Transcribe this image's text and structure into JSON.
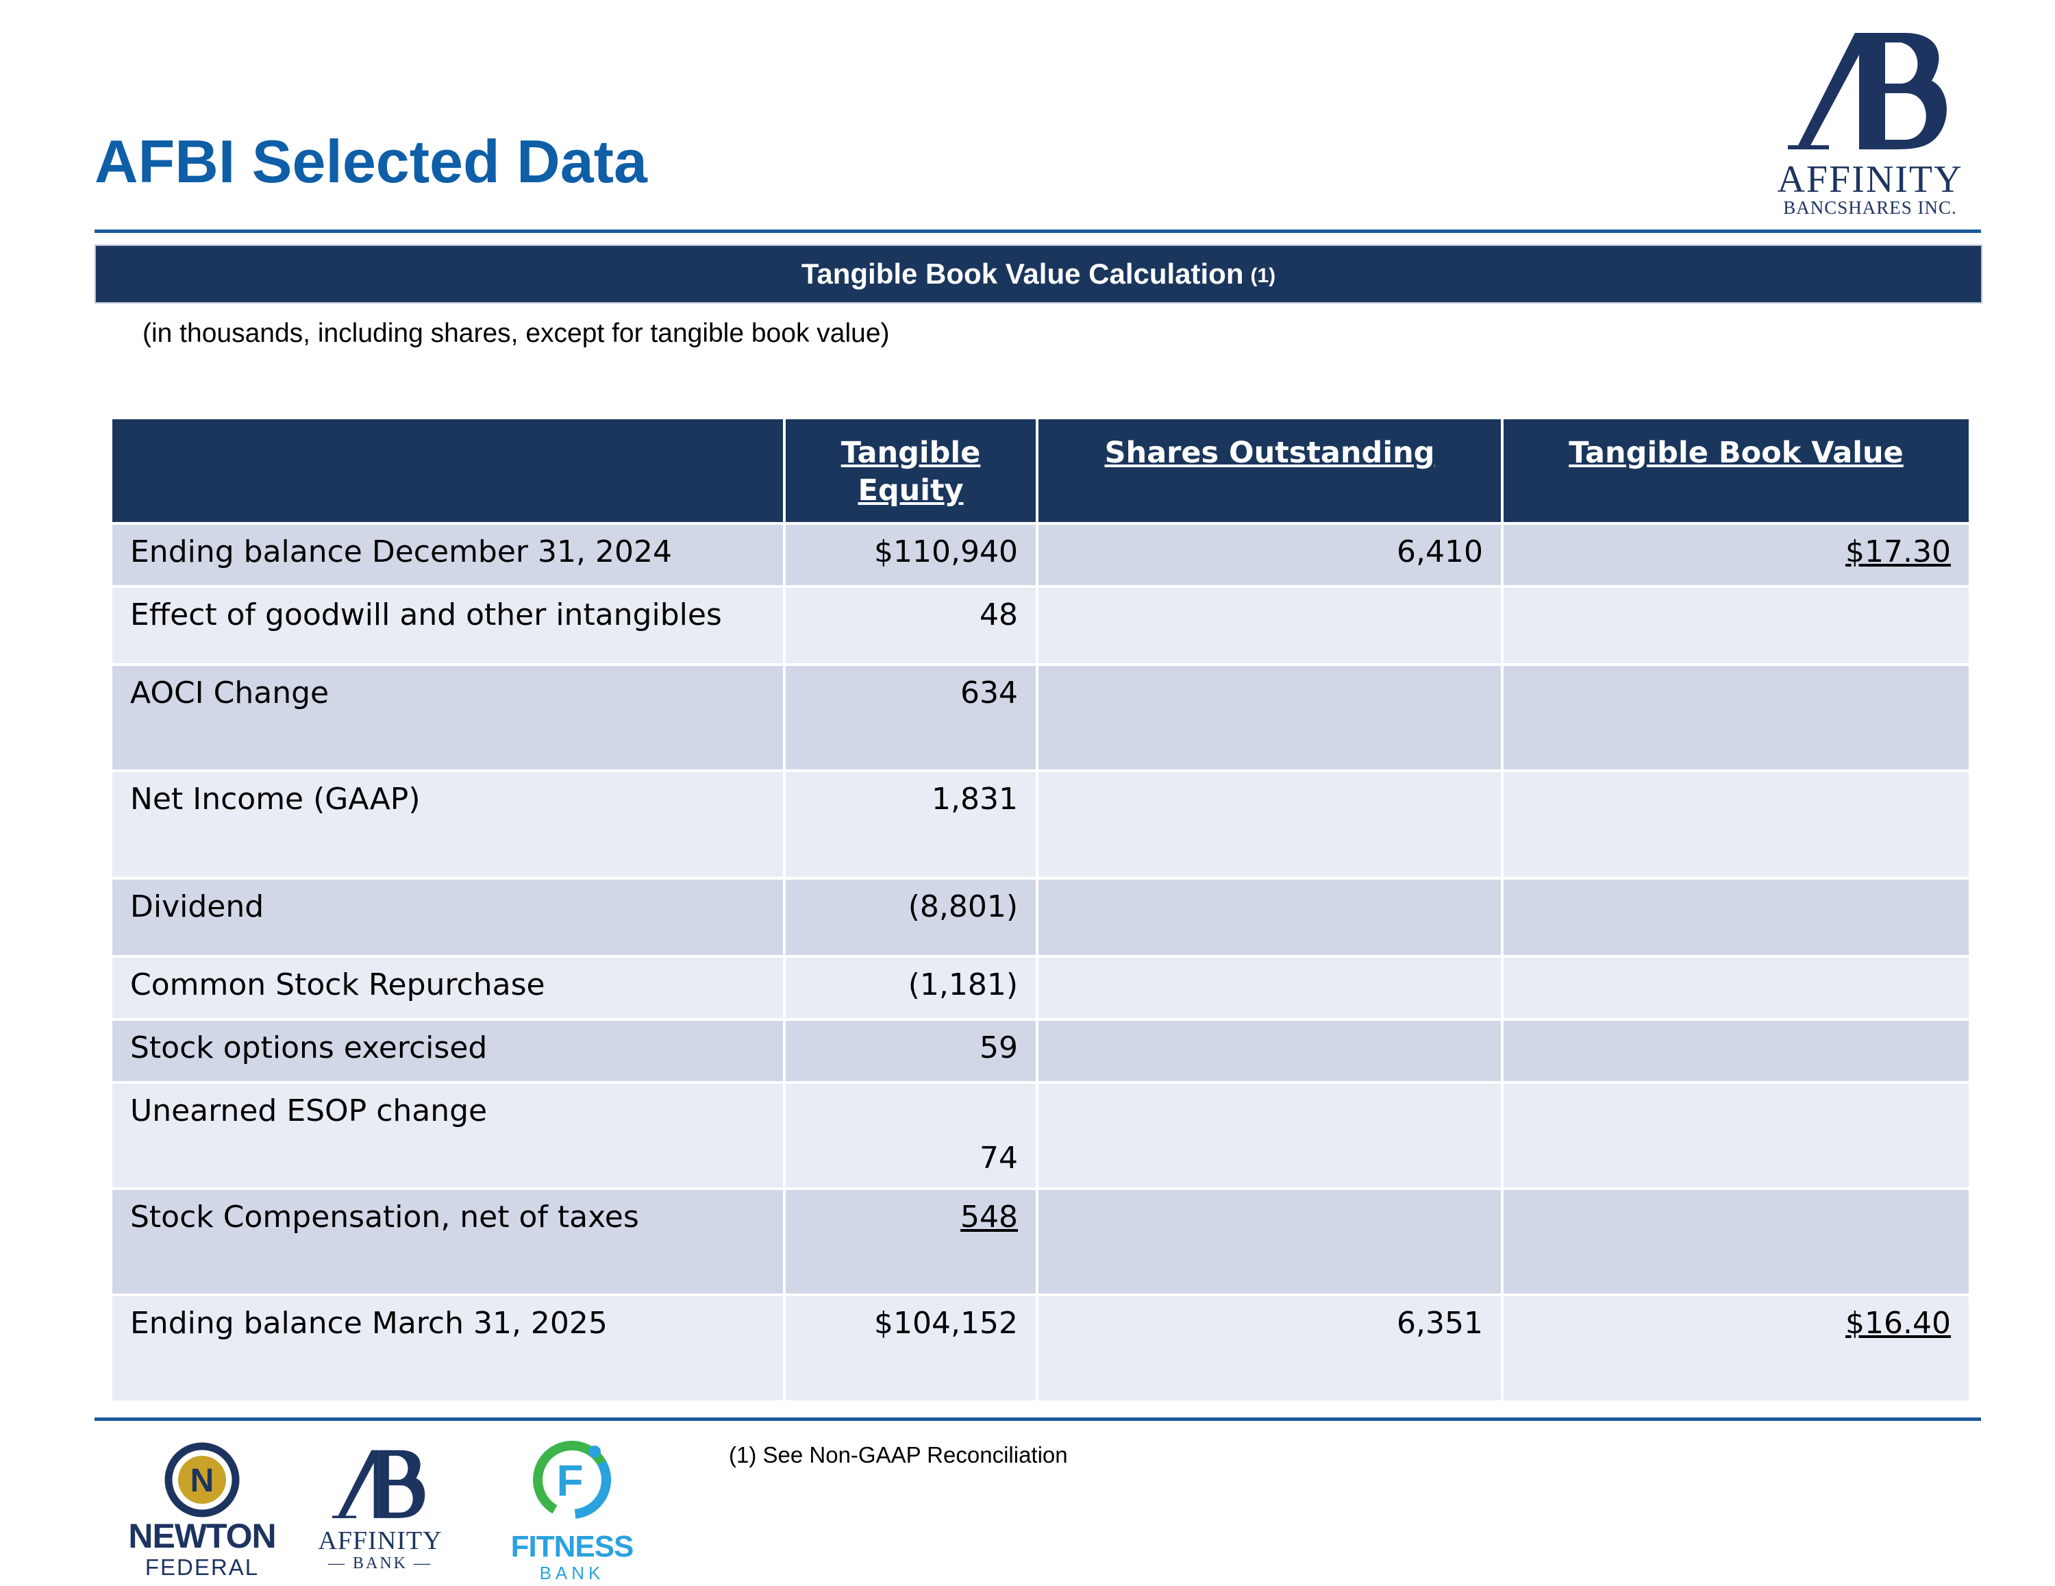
{
  "header": {
    "title": "AFBI Selected Data",
    "logo_line1": "AFFINITY",
    "logo_line2": "BANCSHARES INC."
  },
  "section": {
    "banner_title": "Tangible Book Value Calculation",
    "banner_note": "(1)",
    "subtitle": "(in thousands, including shares, except for tangible book value)"
  },
  "table": {
    "headers": [
      "",
      "Tangible Equity",
      "Shares Outstanding",
      "Tangible Book Value"
    ],
    "rows": [
      {
        "label": "Ending balance December 31, 2024",
        "equity": "$110,940",
        "shares": "6,410",
        "tbv": "$17.30"
      },
      {
        "label": "Effect of goodwill and other intangibles",
        "equity": "48",
        "shares": "",
        "tbv": ""
      },
      {
        "label": "AOCI Change",
        "equity": "634",
        "shares": "",
        "tbv": ""
      },
      {
        "label": "Net Income (GAAP)",
        "equity": "1,831",
        "shares": "",
        "tbv": ""
      },
      {
        "label": "Dividend",
        "equity": "(8,801)",
        "shares": "",
        "tbv": ""
      },
      {
        "label": "Common Stock Repurchase",
        "equity": "(1,181)",
        "shares": "",
        "tbv": ""
      },
      {
        "label": "Stock options exercised",
        "equity": "59",
        "shares": "",
        "tbv": ""
      },
      {
        "label": "Unearned ESOP change",
        "equity": "74",
        "shares": "",
        "tbv": ""
      },
      {
        "label": "Stock Compensation, net of taxes",
        "equity": "548",
        "shares": "",
        "tbv": ""
      },
      {
        "label": "Ending balance March 31, 2025",
        "equity": "$104,152",
        "shares": "6,351",
        "tbv": "$16.40"
      }
    ]
  },
  "footnote": "(1) See Non-GAAP Reconciliation",
  "brands": {
    "newton_line1": "NEWTON",
    "newton_line2": "FEDERAL",
    "newton_mark": "N",
    "affinity_bank_line1": "AFFINITY",
    "affinity_bank_line2": "— BANK —",
    "fitness_line1": "FITNESS",
    "fitness_line2": "BANK",
    "fitness_mark": "F"
  },
  "colors": {
    "title_blue": "#0e5ea8",
    "navy": "#1b365d",
    "row_dark": "#d1d7e6",
    "row_light": "#e8ecf4",
    "newton_gold": "#c9a227",
    "fitness_blue": "#2aa2de",
    "fitness_green": "#3cb44a"
  }
}
